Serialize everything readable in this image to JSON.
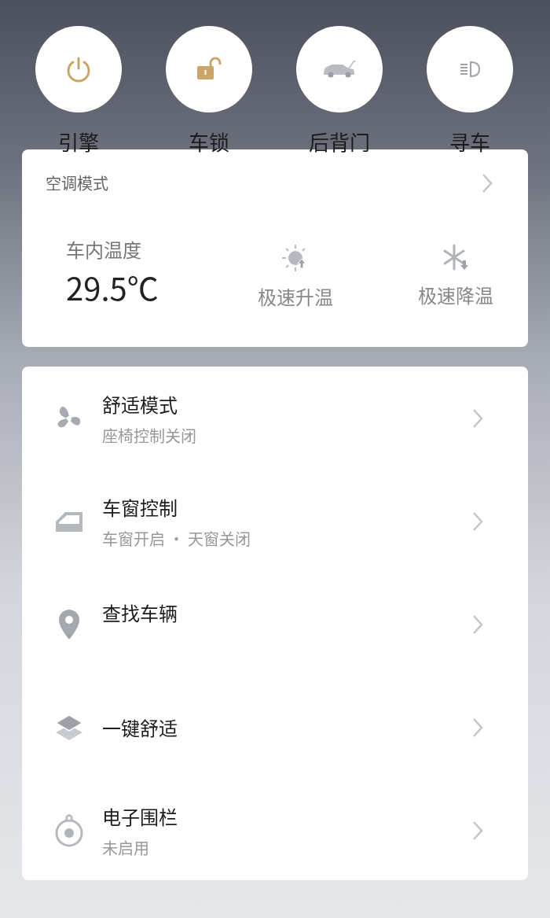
{
  "quick_actions": [
    {
      "kind": "power",
      "label": "引擎"
    },
    {
      "kind": "lock",
      "label": "车锁"
    },
    {
      "kind": "tailgate",
      "label": "后背门"
    },
    {
      "kind": "light",
      "label": "寻车"
    }
  ],
  "climate": {
    "title": "空调模式",
    "temp_label": "车内温度",
    "temp_value": "29.5℃",
    "modes": [
      {
        "kind": "heat",
        "label": "极速升温"
      },
      {
        "kind": "cool",
        "label": "极速降温"
      }
    ]
  },
  "menu": [
    {
      "kind": "fan",
      "title": "舒适模式",
      "subtitle": "座椅控制关闭"
    },
    {
      "kind": "window",
      "title": "车窗控制",
      "subtitle": "车窗开启 · 天窗关闭"
    },
    {
      "kind": "pin",
      "title": "查找车辆"
    },
    {
      "kind": "layers",
      "title": "一键舒适"
    },
    {
      "kind": "fence",
      "title": "电子围栏",
      "subtitle": "未启用"
    }
  ]
}
